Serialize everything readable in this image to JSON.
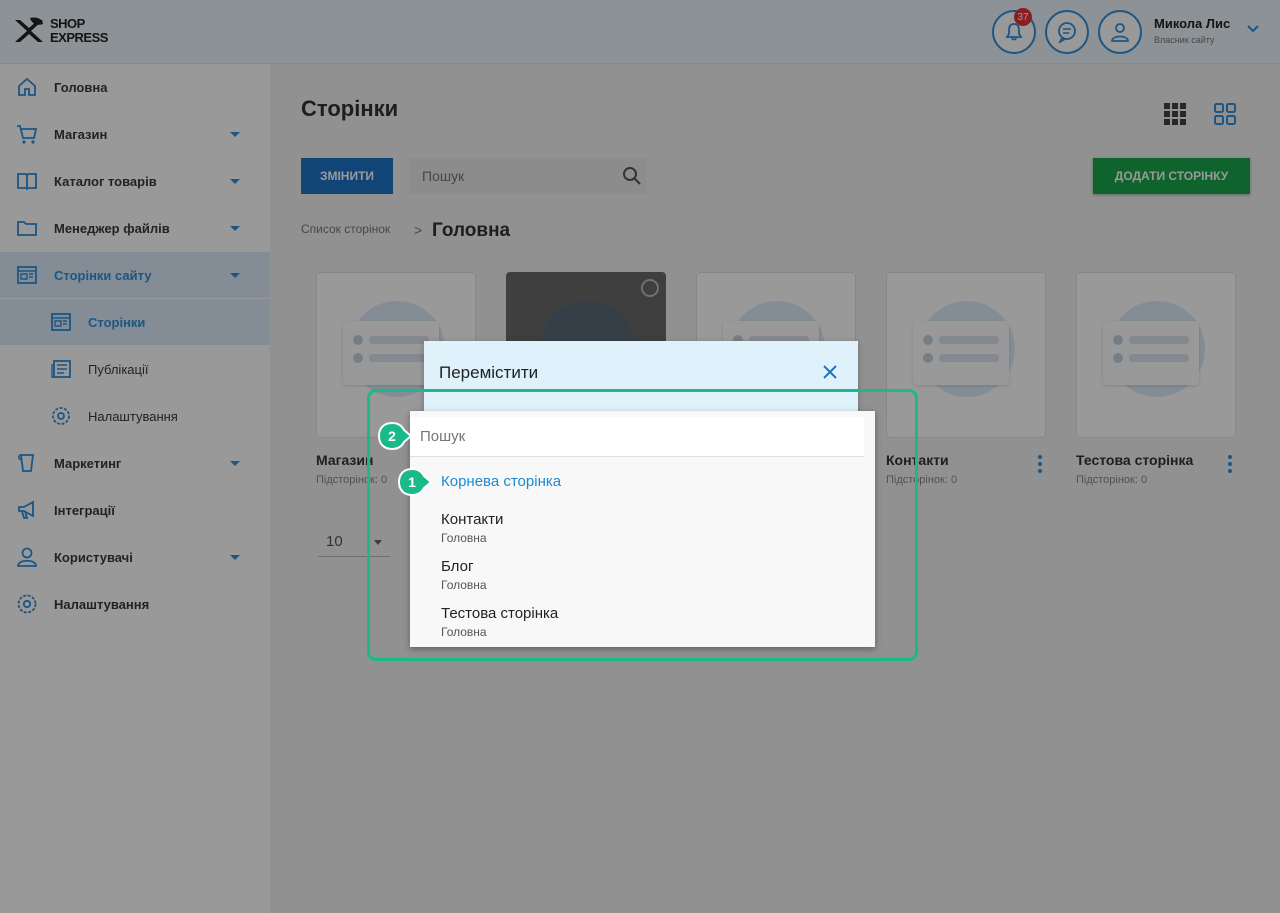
{
  "header": {
    "logo_line1": "SHOP",
    "logo_line2": "EXPRESS",
    "notifications_count": "37",
    "user_name": "Микола Лис",
    "user_role": "Власник сайту"
  },
  "sidebar": {
    "items": [
      {
        "label": "Головна",
        "icon": "home-icon"
      },
      {
        "label": "Магазин",
        "icon": "cart-icon"
      },
      {
        "label": "Каталог товарів",
        "icon": "book-icon"
      },
      {
        "label": "Менеджер файлів",
        "icon": "folder-icon"
      },
      {
        "label": "Сторінки сайту",
        "icon": "browser-icon"
      },
      {
        "label": "Маркетинг",
        "icon": "marketing-icon"
      },
      {
        "label": "Інтеграції",
        "icon": "megaphone-icon"
      },
      {
        "label": "Користувачі",
        "icon": "user-icon"
      },
      {
        "label": "Налаштування",
        "icon": "gear-icon"
      }
    ],
    "subitems": [
      {
        "label": "Сторінки",
        "icon": "pages-icon"
      },
      {
        "label": "Публікації",
        "icon": "news-icon"
      },
      {
        "label": "Налаштування",
        "icon": "gear-icon"
      }
    ]
  },
  "main": {
    "title": "Сторінки",
    "edit_label": "Змінити",
    "search_placeholder": "Пошук",
    "add_label": "Додати сторінку",
    "breadcrumb_link": "Список сторінок",
    "breadcrumb_sep": ">",
    "breadcrumb_current": "Головна",
    "cards": [
      {
        "title": "Магазин",
        "sub": "Підсторінок: 0"
      },
      {
        "title": "Контакти",
        "sub": "Підсторінок: 0"
      },
      {
        "title": "Тестова сторінка",
        "sub": "Підсторінок: 0"
      }
    ],
    "per_page": "10"
  },
  "modal": {
    "title": "Перемістити",
    "search_placeholder": "Пошук",
    "options": [
      {
        "title": "Корнева сторінка",
        "parent": ""
      },
      {
        "title": "Контакти",
        "parent": "Головна"
      },
      {
        "title": "Блог",
        "parent": "Головна"
      },
      {
        "title": "Тестова сторінка",
        "parent": "Головна"
      }
    ]
  },
  "annotations": {
    "marker_1": "1",
    "marker_2": "2"
  },
  "colors": {
    "accent": "#2f8fdc",
    "highlight": "#19b98a",
    "add_button": "#1aa64a",
    "edit_button": "#1f73c6",
    "selected_option": "#1d8ad6"
  }
}
